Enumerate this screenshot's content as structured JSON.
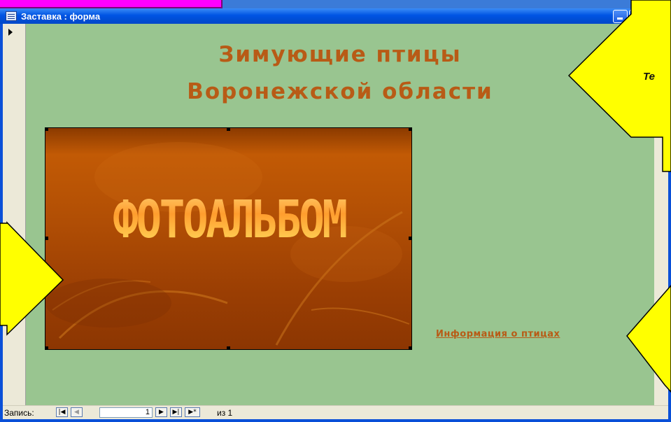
{
  "window": {
    "title": "Заставка : форма"
  },
  "form": {
    "heading_line1": "Зимующие птицы",
    "heading_line2": "Воронежской области",
    "photo_caption": "ФОТОАЛЬБОМ",
    "info_link": "Информация о птицах"
  },
  "navigation": {
    "record_label": "Запись:",
    "current_record": "1",
    "of_text": "из 1",
    "buttons": {
      "first": "|◀",
      "prev": "◀",
      "next": "▶",
      "last": "▶|",
      "new": "▶*"
    }
  },
  "callout": {
    "label": "Те"
  },
  "colors": {
    "form_background": "#99c590",
    "heading": "#b85b16",
    "callout_fill": "#ffff00"
  }
}
